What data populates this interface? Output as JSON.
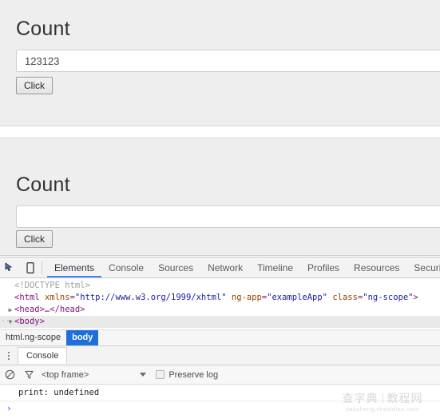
{
  "app_preview": {
    "panels": [
      {
        "title": "Count",
        "input_value": "123123",
        "input_placeholder": "",
        "button_label": "Click"
      },
      {
        "title": "Count",
        "input_value": "",
        "input_placeholder": "",
        "button_label": "Click"
      }
    ]
  },
  "devtools": {
    "toolbar_icons": [
      {
        "name": "inspect-element-icon"
      },
      {
        "name": "device-toolbar-icon"
      }
    ],
    "tabs": [
      {
        "label": "Elements",
        "active": true
      },
      {
        "label": "Console",
        "active": false
      },
      {
        "label": "Sources",
        "active": false
      },
      {
        "label": "Network",
        "active": false
      },
      {
        "label": "Timeline",
        "active": false
      },
      {
        "label": "Profiles",
        "active": false
      },
      {
        "label": "Resources",
        "active": false
      },
      {
        "label": "Security",
        "active": false
      }
    ],
    "active_tab_underline_color": "#4285f4",
    "dom_tree": {
      "doctype": "<!DOCTYPE html>",
      "html_open": {
        "lt": "<",
        "tag": "html",
        "attr_xmlns": "xmlns",
        "val_xmlns": "\"http://www.w3.org/1999/xhtml\"",
        "attr_ngapp": "ng-app",
        "val_ngapp": "\"exampleApp\"",
        "attr_class": "class",
        "val_class": "\"ng-scope\"",
        "gt": ">"
      },
      "head_row": {
        "triangle": "▶",
        "text": "<head>…</head>"
      },
      "body_row": {
        "triangle": "▼",
        "dots": "···",
        "text": "<body>",
        "selected": true
      }
    },
    "breadcrumb": [
      {
        "label": "html.ng-scope",
        "active": false
      },
      {
        "label": "body",
        "active": true
      }
    ],
    "drawer": {
      "menu_icon": "kebab-menu-icon",
      "tabs": [
        {
          "label": "Console",
          "active": true
        }
      ],
      "filter_bar": {
        "clear_icon": "clear-console-icon",
        "filter_icon": "filter-funnel-icon",
        "frame_selector_value": "<top frame>",
        "dropdown_icon": "chevron-down-icon",
        "preserve_log_label": "Preserve log",
        "preserve_log_checked": false
      },
      "messages": [
        {
          "text": "print: undefined"
        }
      ],
      "prompt_symbol": "›"
    }
  },
  "watermark": {
    "cn_left": "查字典",
    "cn_right": "教程网",
    "url": "jiaocheng.chazidian.com"
  }
}
